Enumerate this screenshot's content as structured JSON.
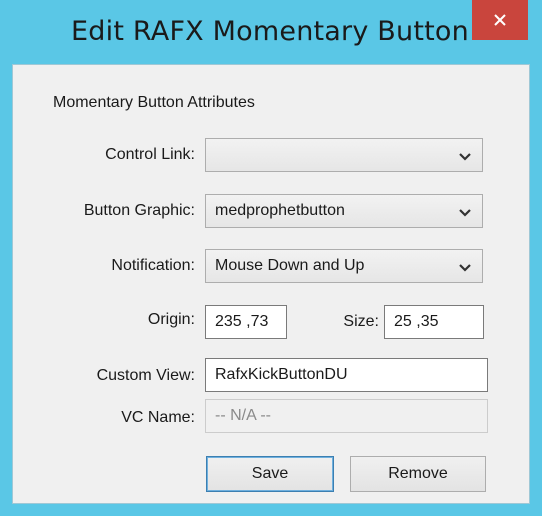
{
  "window": {
    "title": "Edit RAFX Momentary Button",
    "close_glyph": "×"
  },
  "attributes": {
    "section_label": "Momentary Button Attributes",
    "control_link": {
      "label": "Control Link:",
      "value": ""
    },
    "button_graphic": {
      "label": "Button Graphic:",
      "value": "medprophetbutton"
    },
    "notification": {
      "label": "Notification:",
      "value": "Mouse Down and Up"
    },
    "origin": {
      "label": "Origin:",
      "value": "235 ,73"
    },
    "size": {
      "label": "Size:",
      "value": "25 ,35"
    },
    "custom_view": {
      "label": "Custom View:",
      "value": "RafxKickButtonDU"
    },
    "vc_name": {
      "label": "VC Name:",
      "value": "-- N/A --"
    }
  },
  "buttons": {
    "save_label": "Save",
    "remove_label": "Remove"
  },
  "colors": {
    "frame": "#5ac7e6",
    "close_bg": "#c9453d",
    "client_bg": "#f0f0f0",
    "default_button_border": "#3c7fb1"
  },
  "icons": {
    "close": "close-icon",
    "dropdown": "chevron-down-icon"
  }
}
